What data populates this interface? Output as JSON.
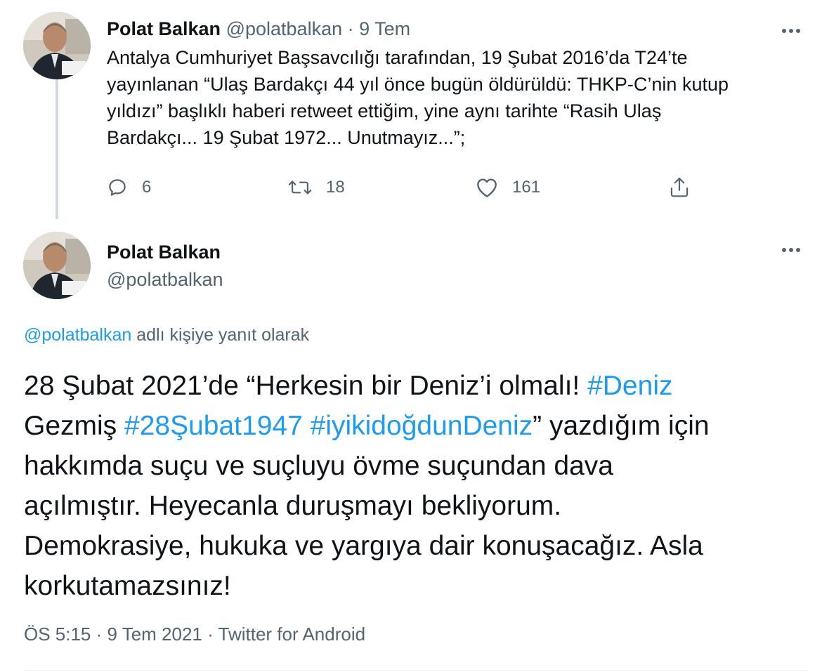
{
  "first_tweet": {
    "author_name": "Polat Balkan",
    "author_handle": "@polatbalkan",
    "separator": "·",
    "date": "9 Tem",
    "text_lines": [
      "Antalya Cumhuriyet Başsavcılığı tarafından, 19 Şubat 2016’da T24’te",
      "yayınlanan “Ulaş Bardakçı 44 yıl önce bugün öldürüldü: THKP-C’nin kutup",
      "yıldızı” başlıklı haberi retweet ettiğim, yine aynı tarihte “Rasih Ulaş",
      "Bardakçı... 19 Şubat 1972... Unutmayız...”;"
    ],
    "reply_count": "6",
    "retweet_count": "18",
    "like_count": "161"
  },
  "main_tweet": {
    "author_name": "Polat Balkan",
    "author_handle": "@polatbalkan",
    "replying_to_handle": "@polatbalkan",
    "replying_to_suffix": " adlı kişiye yanıt olarak",
    "line1_text": "28 Şubat 2021’de “Herkesin bir Deniz’i olmalı! ",
    "line1_hashtag": "#Deniz",
    "line2_hashtag_cont": "Gezmiş",
    "line2_space1": " ",
    "line2_hashtag1": "#28Şubat1947",
    "line2_space2": " ",
    "line2_hashtag2": "#iyikidoğdunDeniz",
    "line2_text": "” yazdığım için",
    "lines": [
      "hakkımda suçu ve suçluyu övme suçundan dava",
      "açılmıştır. Heyecanla duruşmayı bekliyorum.",
      "Demokrasiye, hukuka ve yargıya dair konuşacağız. Asla",
      "korkutamazsınız!"
    ],
    "timestamp": "ÖS 5:15 · 9 Tem 2021 · Twitter for Android"
  },
  "colors": {
    "link": "#1d9bf0",
    "muted": "#536471",
    "text": "#0f1419",
    "thread_line": "#cfd9de"
  },
  "icons": [
    "reply-icon",
    "retweet-icon",
    "like-icon",
    "share-icon",
    "more-icon"
  ]
}
